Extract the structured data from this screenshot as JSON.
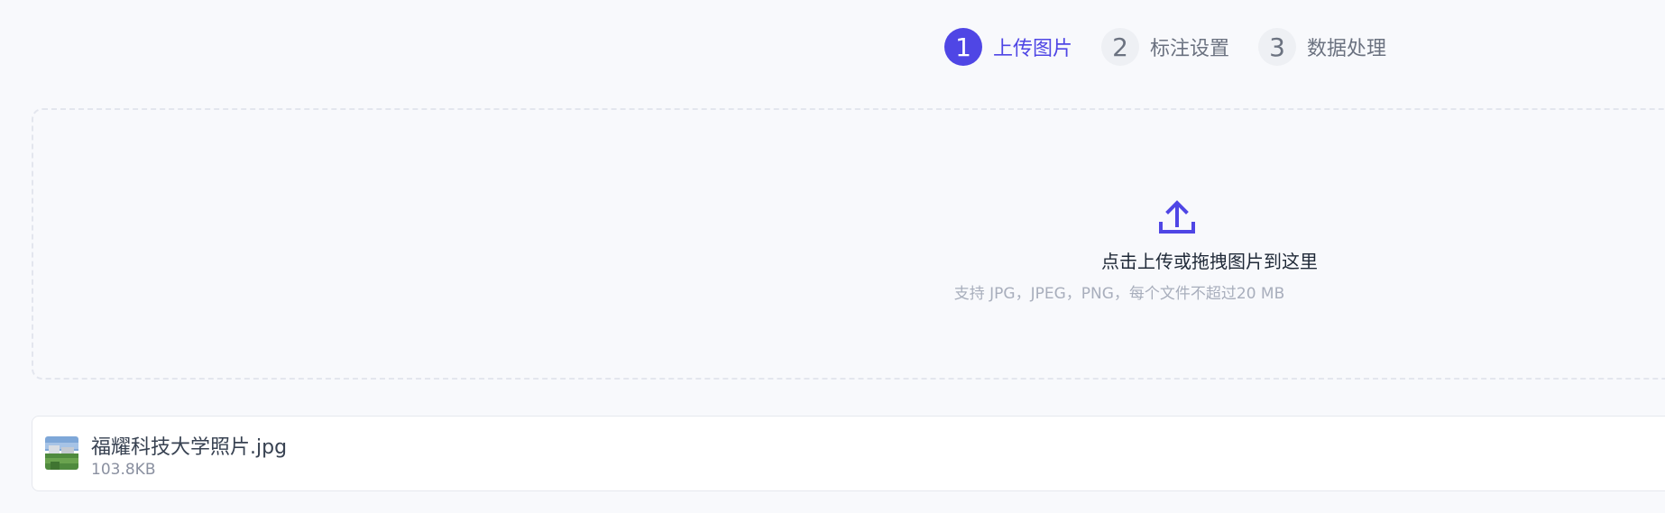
{
  "steps": [
    {
      "number": "1",
      "label": "上传图片",
      "active": true
    },
    {
      "number": "2",
      "label": "标注设置",
      "active": false
    },
    {
      "number": "3",
      "label": "数据处理",
      "active": false
    }
  ],
  "dropzone": {
    "title": "点击上传或拖拽图片到这里",
    "hint": "支持 JPG，JPEG，PNG，每个文件不超过20 MB",
    "icon": "upload-icon"
  },
  "file": {
    "name": "福耀科技大学照片.jpg",
    "size": "103.8KB",
    "icon": "image-thumbnail"
  },
  "colors": {
    "accent": "#4f46e5",
    "muted": "#6b7280",
    "background": "#f8f9fc"
  }
}
